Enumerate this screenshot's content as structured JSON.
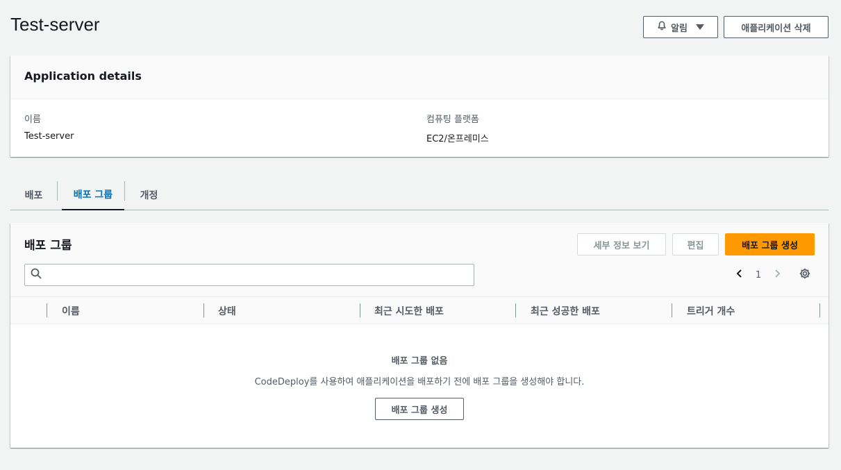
{
  "page": {
    "title": "Test-server"
  },
  "header_actions": {
    "alarm_label": "알림",
    "delete_label": "애플리케이션 삭제"
  },
  "details": {
    "title": "Application details",
    "name_label": "이름",
    "name_value": "Test-server",
    "platform_label": "컴퓨팅 플랫폼",
    "platform_value": "EC2/온프레미스"
  },
  "tabs": [
    {
      "label": "배포",
      "active": false
    },
    {
      "label": "배포 그룹",
      "active": true
    },
    {
      "label": "개정",
      "active": false
    }
  ],
  "deployment_groups": {
    "title": "배포 그룹",
    "view_details_label": "세부 정보 보기",
    "edit_label": "편집",
    "create_label": "배포 그룹 생성",
    "search_placeholder": "",
    "page_number": "1",
    "columns": [
      "이름",
      "상태",
      "최근 시도한 배포",
      "최근 성공한 배포",
      "트리거 개수"
    ],
    "empty_title": "배포 그룹 없음",
    "empty_description": "CodeDeploy를 사용하여 애플리케이션을 배포하기 전에 배포 그룹을 생성해야 합니다.",
    "empty_create_label": "배포 그룹 생성"
  },
  "colors": {
    "accent": "#ff9900",
    "tab_active": "#0073bb",
    "background": "#f2f3f3"
  },
  "icons": {
    "alarm": "bell-icon",
    "search": "search-icon",
    "prev": "chevron-left-icon",
    "next": "chevron-right-icon",
    "settings": "gear-icon"
  }
}
